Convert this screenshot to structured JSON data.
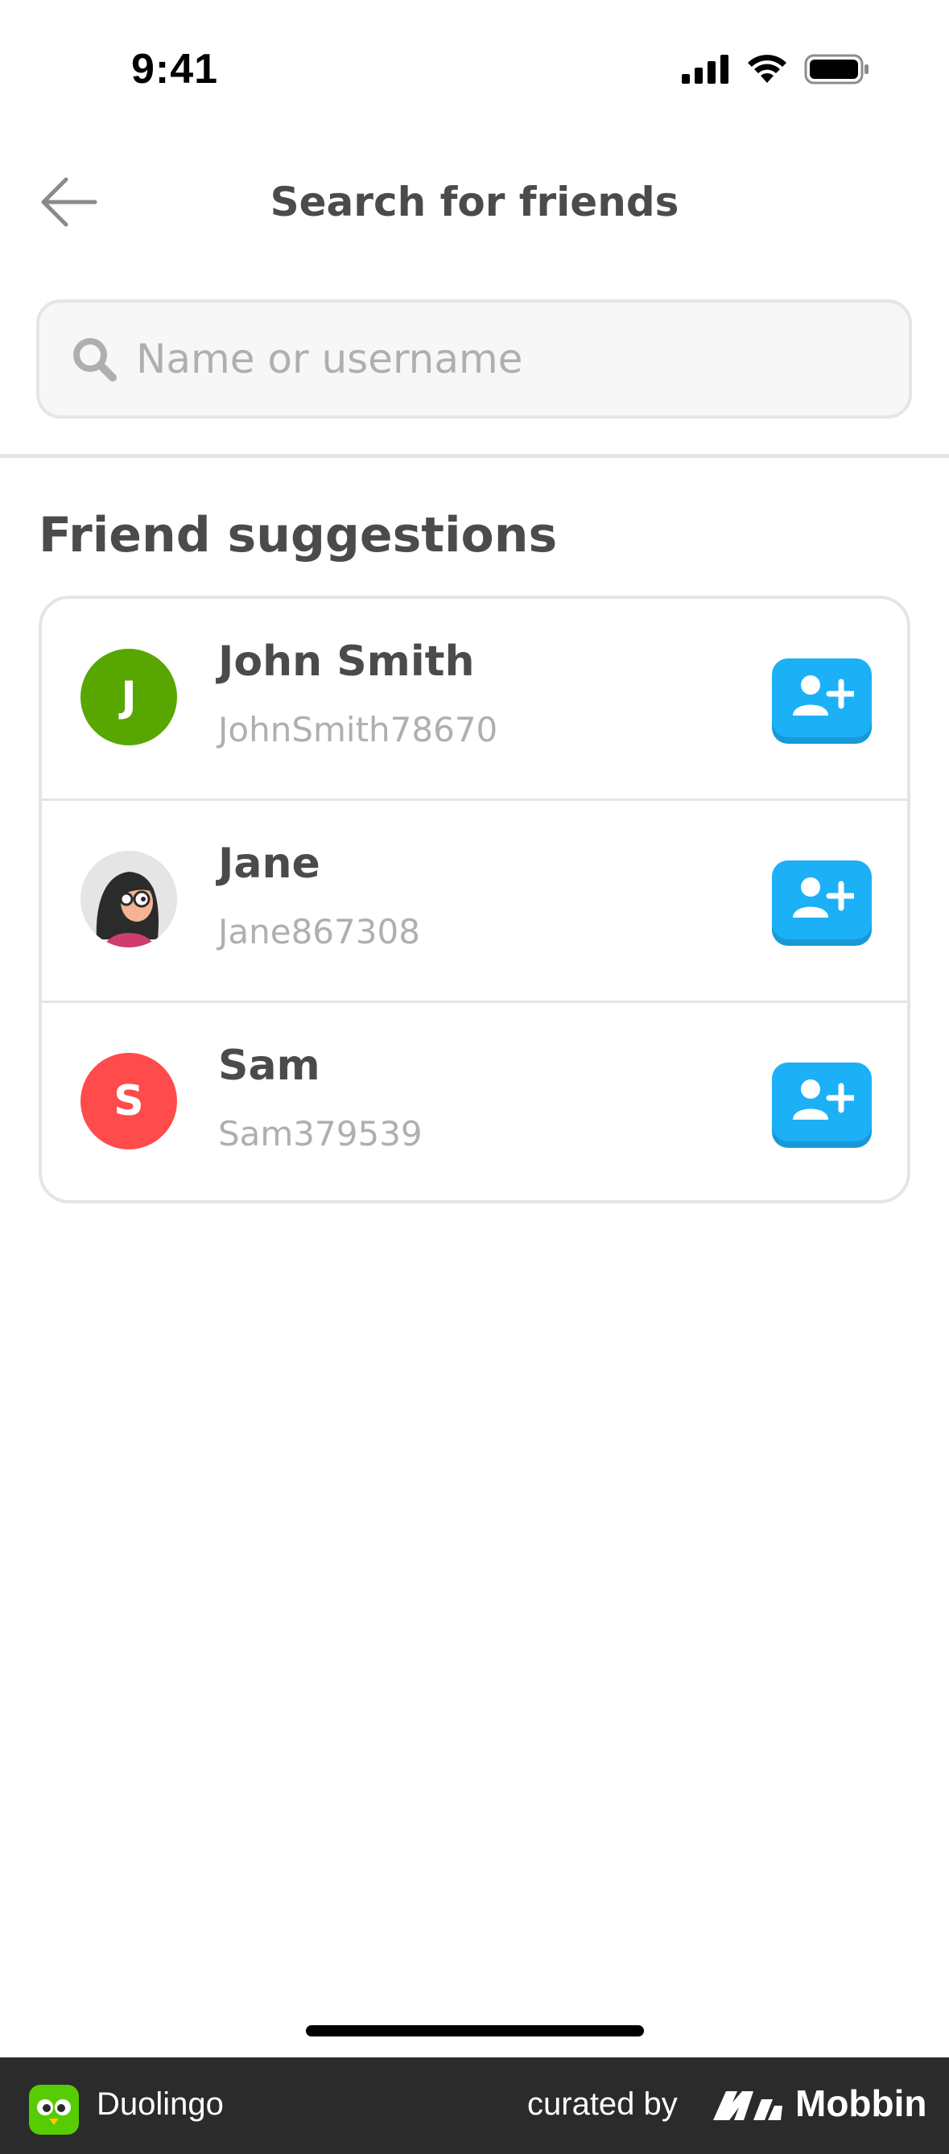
{
  "status_bar": {
    "time": "9:41",
    "icons": [
      "cellular-signal-icon",
      "wifi-icon",
      "battery-icon"
    ]
  },
  "header": {
    "title": "Search for friends",
    "back_icon": "arrow-left-icon"
  },
  "search": {
    "placeholder": "Name or username",
    "value": "",
    "icon": "search-icon"
  },
  "suggestions": {
    "title": "Friend suggestions",
    "items": [
      {
        "name": "John Smith",
        "username": "JohnSmith78670",
        "avatar_letter": "J",
        "avatar_color": "#58a700"
      },
      {
        "name": "Jane",
        "username": "Jane867308",
        "avatar_letter": "",
        "avatar_color": "#e5e5e5"
      },
      {
        "name": "Sam",
        "username": "Sam379539",
        "avatar_letter": "S",
        "avatar_color": "#ff4b4b"
      }
    ],
    "add_icon": "add-friend-icon",
    "add_button_color": "#1cb0f6"
  },
  "footer": {
    "app_name": "Duolingo",
    "curated_by": "curated by",
    "brand": "Mobbin"
  }
}
